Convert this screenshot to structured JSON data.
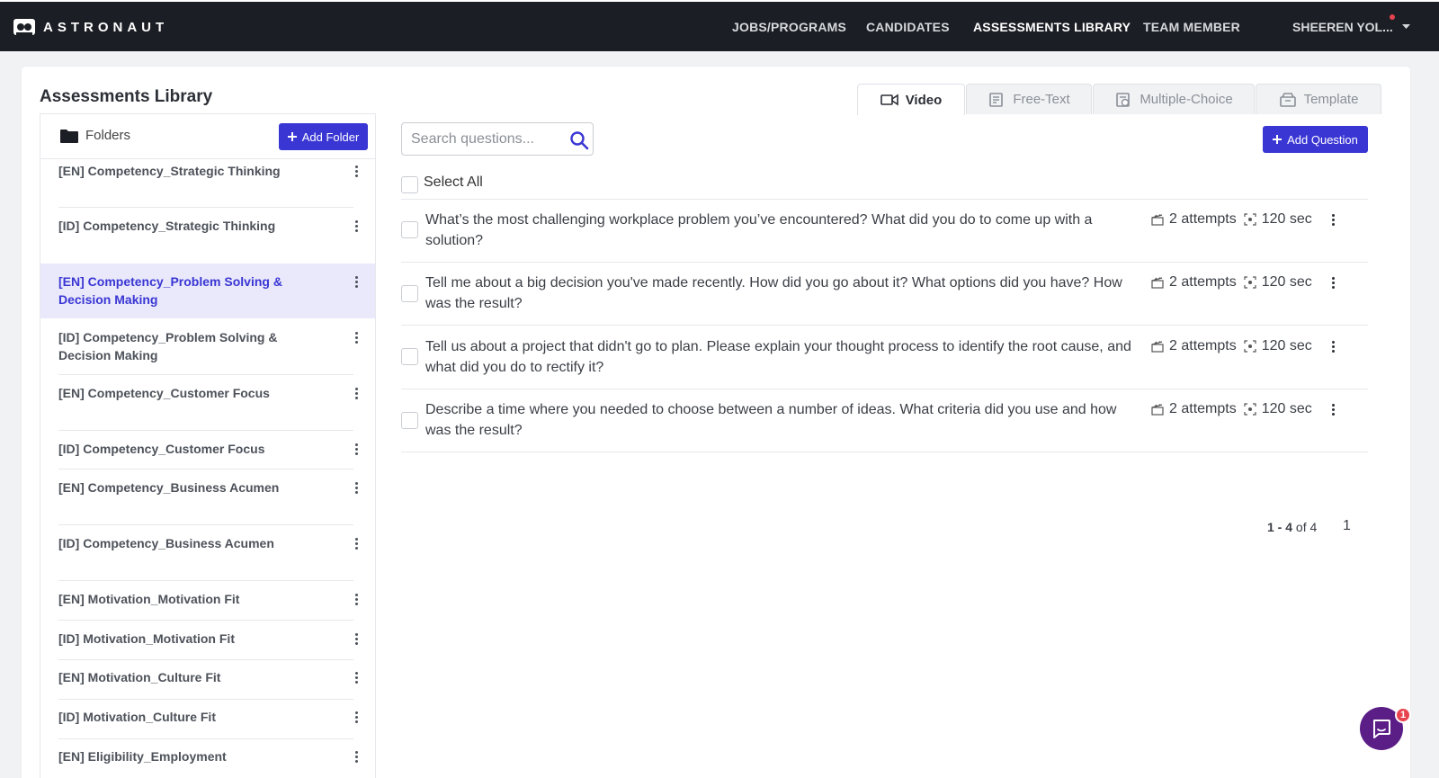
{
  "brand": {
    "name": "ASTRONAUT",
    "icon": "astronaut-logo-icon"
  },
  "nav": {
    "items": [
      {
        "label": "JOBS/PROGRAMS",
        "active": false
      },
      {
        "label": "CANDIDATES",
        "active": false
      },
      {
        "label": "ASSESSMENTS LIBRARY",
        "active": true
      },
      {
        "label": "TEAM MEMBER",
        "active": false
      }
    ],
    "user_label": "SHEEREN YOL..."
  },
  "page": {
    "title": "Assessments Library"
  },
  "tabs": [
    {
      "label": "Video",
      "icon": "video-camera-icon",
      "active": true
    },
    {
      "label": "Free-Text",
      "icon": "free-text-icon",
      "active": false
    },
    {
      "label": "Multiple-Choice",
      "icon": "multiple-choice-icon",
      "active": false
    },
    {
      "label": "Template",
      "icon": "template-icon",
      "active": false
    }
  ],
  "folders": {
    "header_label": "Folders",
    "add_label": "Add Folder",
    "items": [
      {
        "name": "[EN] Competency_Strategic Thinking",
        "selected": false
      },
      {
        "name": "[ID] Competency_Strategic Thinking",
        "selected": false
      },
      {
        "name": "[EN] Competency_Problem Solving & Decision Making",
        "selected": true
      },
      {
        "name": "[ID] Competency_Problem Solving & Decision Making",
        "selected": false
      },
      {
        "name": "[EN] Competency_Customer Focus",
        "selected": false
      },
      {
        "name": "[ID] Competency_Customer Focus",
        "selected": false
      },
      {
        "name": "[EN] Competency_Business Acumen",
        "selected": false
      },
      {
        "name": "[ID] Competency_Business Acumen",
        "selected": false
      },
      {
        "name": "[EN] Motivation_Motivation Fit",
        "selected": false
      },
      {
        "name": "[ID] Motivation_Motivation Fit",
        "selected": false
      },
      {
        "name": "[EN] Motivation_Culture Fit",
        "selected": false
      },
      {
        "name": "[ID] Motivation_Culture Fit",
        "selected": false
      },
      {
        "name": "[EN] Eligibility_Employment",
        "selected": false
      }
    ]
  },
  "search": {
    "placeholder": "Search questions..."
  },
  "add_question_label": "Add Question",
  "select_all_label": "Select All",
  "questions": [
    {
      "text": "What’s the most challenging workplace problem you’ve encountered? What did you do to come up with a solution?",
      "attempts": "2 attempts",
      "duration": "120 sec"
    },
    {
      "text": "Tell me about a big decision you've made recently. How did you go about it? What options did you have? How was the result?",
      "attempts": "2 attempts",
      "duration": "120 sec"
    },
    {
      "text": "Tell us about a project that didn't go to plan. Please explain your thought process to identify the root cause, and what did you do to rectify it?",
      "attempts": "2 attempts",
      "duration": "120 sec"
    },
    {
      "text": "Describe a time where you needed to choose between a number of ideas. What criteria did you use and how was the result?",
      "attempts": "2 attempts",
      "duration": "120 sec"
    }
  ],
  "pagination": {
    "range": "1 - 4",
    "of_text": "of 4",
    "page": "1"
  },
  "chat": {
    "badge_count": "1",
    "icon": "chat-bubble-icon"
  },
  "colors": {
    "accent": "#3a36d4",
    "topbar": "#1b1e24",
    "selected_bg": "#e9e9fb",
    "chat": "#5b1d86",
    "badge": "#e8444f"
  }
}
